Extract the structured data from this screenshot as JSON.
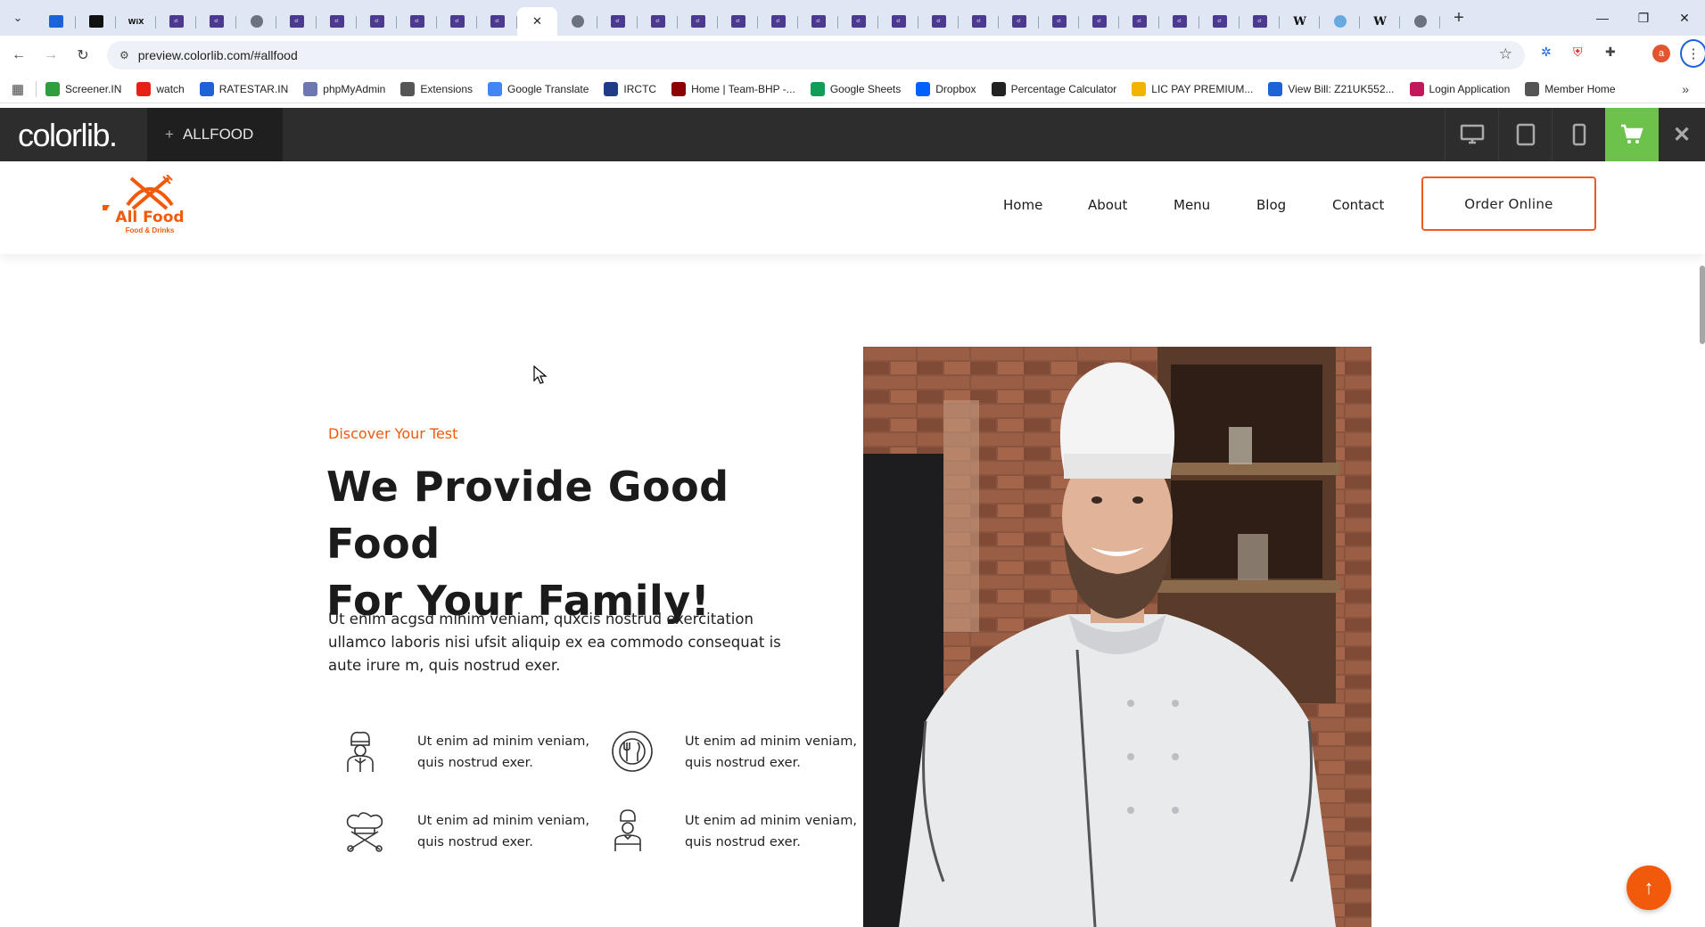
{
  "browser": {
    "active_tab_close": "✕",
    "new_tab": "+",
    "url": "preview.colorlib.com/#allfood",
    "profile_initial": "a"
  },
  "bookmarks": [
    {
      "label": "Screener.IN",
      "icon": "bar-chart-icon",
      "color": "#2e9e3e"
    },
    {
      "label": "watch",
      "icon": "youtube-icon",
      "color": "#e62117"
    },
    {
      "label": "RATESTAR.IN",
      "icon": "star-icon",
      "color": "#1e62d8"
    },
    {
      "label": "phpMyAdmin",
      "icon": "phpmyadmin-icon",
      "color": "#6c78af"
    },
    {
      "label": "Extensions",
      "icon": "puzzle-icon",
      "color": "#555555"
    },
    {
      "label": "Google Translate",
      "icon": "translate-icon",
      "color": "#4285f4"
    },
    {
      "label": "IRCTC",
      "icon": "irctc-icon",
      "color": "#1f3c88"
    },
    {
      "label": "Home | Team-BHP -...",
      "icon": "team-bhp-icon",
      "color": "#8b0000"
    },
    {
      "label": "Google Sheets",
      "icon": "sheets-icon",
      "color": "#0f9d58"
    },
    {
      "label": "Dropbox",
      "icon": "dropbox-icon",
      "color": "#0061fe"
    },
    {
      "label": "Percentage Calculator",
      "icon": "percent-icon",
      "color": "#222222"
    },
    {
      "label": "LIC PAY PREMIUM...",
      "icon": "lic-icon",
      "color": "#f2b400"
    },
    {
      "label": "View Bill: Z21UK552...",
      "icon": "bill-icon",
      "color": "#1e62d8"
    },
    {
      "label": "Login Application",
      "icon": "login-icon",
      "color": "#c2185b"
    },
    {
      "label": "Member Home",
      "icon": "globe-icon",
      "color": "#555555"
    }
  ],
  "colorlib_bar": {
    "logo": "colorlib.",
    "theme_plus": "+",
    "theme_name": "ALLFOOD",
    "accent": "#6cc24a"
  },
  "site": {
    "brand_name": "All Food",
    "brand_sub": "Food & Drinks",
    "brand_color": "#f15a0a",
    "nav": [
      "Home",
      "About",
      "Menu",
      "Blog",
      "Contact"
    ],
    "order_button": "Order Online"
  },
  "hero": {
    "tagline": "Discover Your Test",
    "headline_line1": "We Provide Good Food",
    "headline_line2": "For Your Family!",
    "lead": "Ut enim acgsd minim veniam, quxcis nostrud exercitation ullamco laboris nisi ufsit aliquip ex ea commodo consequat is aute irure m, quis nostrud exer.",
    "features": [
      {
        "icon": "chef-icon",
        "text": "Ut enim ad minim veniam, quis nostrud exer."
      },
      {
        "icon": "plate-cutlery-icon",
        "text": "Ut enim ad minim veniam, quis nostrud exer."
      },
      {
        "icon": "chef-hat-utensils-icon",
        "text": "Ut enim ad minim veniam, quis nostrud exer."
      },
      {
        "icon": "waiter-icon",
        "text": "Ut enim ad minim veniam, quis nostrud exer."
      }
    ]
  },
  "scroll_top_icon": "arrow-up-icon"
}
